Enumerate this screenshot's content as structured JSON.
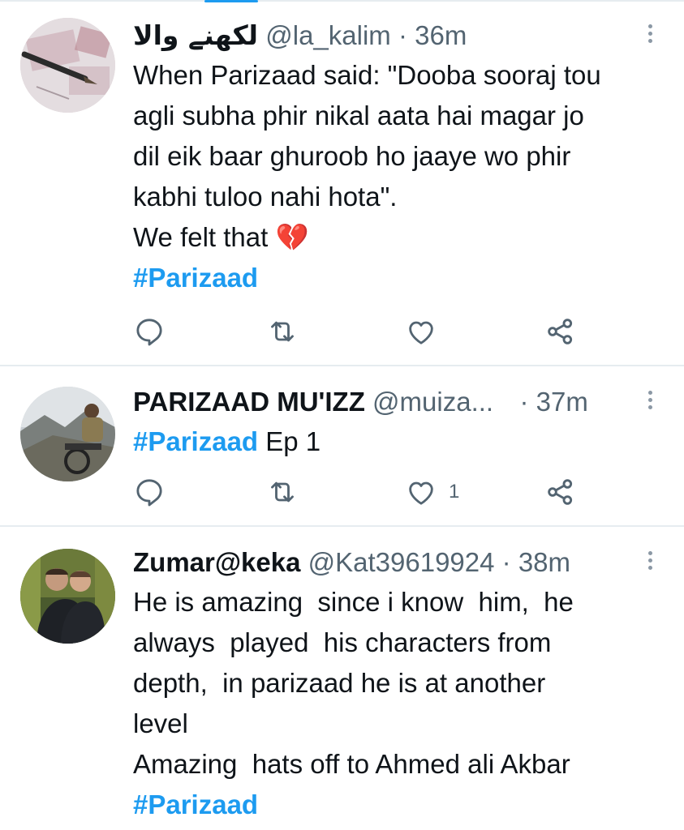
{
  "tweets": [
    {
      "author": "لکھنے والا",
      "handle": "@la_kalim",
      "separator": "·",
      "time": "36m",
      "lines": [
        "When Parizaad said: \"Dooba sooraj tou",
        "agli subha phir nikal aata hai magar jo",
        "dil eik baar ghuroob ho jaaye wo phir",
        "kabhi tuloo nahi hota\".",
        "We felt that"
      ],
      "emoji": "💔",
      "hashtag": "#Parizaad",
      "like_count": ""
    },
    {
      "author": "PARIZAAD MU'IZZ",
      "handle": "@muiza...",
      "separator": "·",
      "time": "37m",
      "hashtag": "#Parizaad",
      "hashtag_suffix": " Ep 1",
      "like_count": "1"
    },
    {
      "author": "Zumar@keka",
      "handle": "@Kat39619924",
      "separator": "·",
      "time": "38m",
      "lines": [
        "He is amazing  since i know  him,  he",
        "always  played  his characters from",
        "depth,  in parizaad he is at another",
        "level",
        "Amazing  hats off to Ahmed ali Akbar"
      ],
      "hashtag": "#Parizaad"
    }
  ],
  "colors": {
    "link": "#1d9bf0",
    "secondary": "#536471",
    "divider": "#e6ecf0"
  },
  "icons": [
    "reply-icon",
    "retweet-icon",
    "like-icon",
    "share-icon",
    "more-icon",
    "broken-heart-emoji"
  ]
}
